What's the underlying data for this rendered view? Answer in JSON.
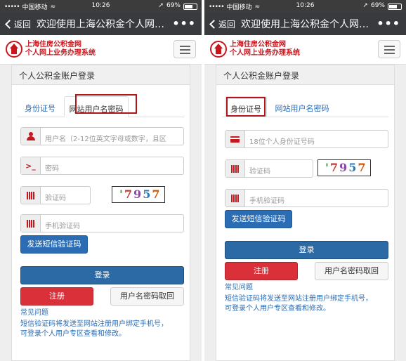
{
  "status": {
    "carrier": "中国移动",
    "time": "10:26",
    "battery": "69%",
    "battery_level": 0.69
  },
  "nav": {
    "back_label": "返回",
    "title": "欢迎使用上海公积金个人网…",
    "more": "•••"
  },
  "site": {
    "name_line1": "上海住房公积金网",
    "name_line2": "个人网上业务办理系统"
  },
  "panel_title": "个人公积金账户登录",
  "tabs": {
    "id_card": "身份证号",
    "web_user": "网站用户名密码"
  },
  "left": {
    "username_placeholder": "用户名（2-12位英文字母或数字，且区",
    "password_placeholder": "密码",
    "captcha_placeholder": "验证码",
    "sms_placeholder": "手机验证码",
    "send_sms": "发送短信验证码",
    "login": "登录",
    "register": "注册",
    "recover": "用户名密码取回",
    "faq_title": "常见问题",
    "faq_line1": "短信验证码将发送至网站注册用户绑定手机号，",
    "faq_line2": "可登录个人用户专区查看和修改。"
  },
  "right": {
    "id_placeholder": "18位个人身份证号码",
    "captcha_placeholder": "验证码",
    "sms_placeholder": "手机验证码",
    "send_sms": "发送短信验证码",
    "login": "登录",
    "register": "注册",
    "recover": "用户名密码取回",
    "faq_title": "常见问题",
    "faq_line1": "短信验证码将发送至网站注册用户绑定手机号，",
    "faq_line2": "可登录个人用户专区查看和修改。"
  },
  "captcha": {
    "c1": "'",
    "c2": "7",
    "c3": "9",
    "c4": "5",
    "c5": "7"
  },
  "colors": {
    "brand_red": "#c8161d",
    "link_blue": "#2a6db5",
    "nav_bg": "#393a3e"
  }
}
